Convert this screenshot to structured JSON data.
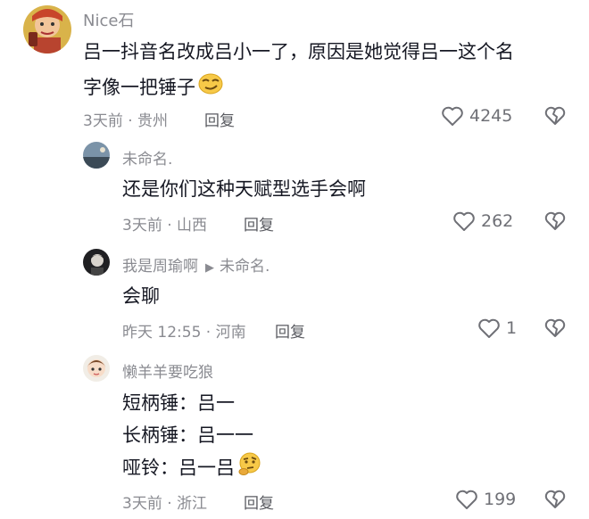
{
  "comments": [
    {
      "username": "Nice石",
      "lines": [
        "吕一抖音名改成吕小一了，原因是她觉得吕一这个名",
        "字像一把锤子"
      ],
      "time_location": "3天前 · 贵州",
      "reply_label": "回复",
      "likes": "4245"
    },
    {
      "username": "未命名.",
      "lines": [
        "还是你们这种天赋型选手会啊"
      ],
      "time_location": "3天前 · 山西",
      "reply_label": "回复",
      "likes": "262"
    },
    {
      "username": "我是周瑜啊",
      "reply_to": "未命名.",
      "lines": [
        "会聊"
      ],
      "time_location": "昨天 12:55 · 河南",
      "reply_label": "回复",
      "likes": "1"
    },
    {
      "username": "懒羊羊要吃狼",
      "lines": [
        "短柄锤：吕一",
        "长柄锤：吕一一",
        "哑铃：吕一吕"
      ],
      "time_location": "3天前 · 浙江",
      "reply_label": "回复",
      "likes": "199"
    }
  ],
  "icons": {
    "like": "heart-outline-icon",
    "dislike": "broken-heart-icon"
  },
  "colors": {
    "meta_gray": "#8a8b91",
    "text": "#161823",
    "icon_gray": "#6f7076"
  }
}
